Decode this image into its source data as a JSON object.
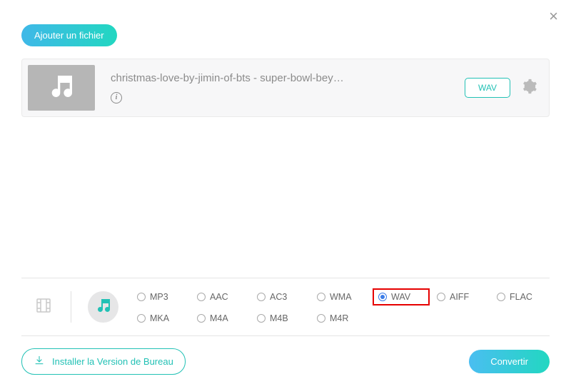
{
  "close_label": "×",
  "add_file_label": "Ajouter un fichier",
  "file": {
    "title": "christmas-love-by-jimin-of-bts - super-bowl-bey…",
    "selected_format": "WAV"
  },
  "formats": [
    {
      "name": "MP3",
      "checked": false,
      "highlighted": false
    },
    {
      "name": "AAC",
      "checked": false,
      "highlighted": false
    },
    {
      "name": "AC3",
      "checked": false,
      "highlighted": false
    },
    {
      "name": "WMA",
      "checked": false,
      "highlighted": false
    },
    {
      "name": "WAV",
      "checked": true,
      "highlighted": true
    },
    {
      "name": "AIFF",
      "checked": false,
      "highlighted": false
    },
    {
      "name": "FLAC",
      "checked": false,
      "highlighted": false
    },
    {
      "name": "MKA",
      "checked": false,
      "highlighted": false
    },
    {
      "name": "M4A",
      "checked": false,
      "highlighted": false
    },
    {
      "name": "M4B",
      "checked": false,
      "highlighted": false
    },
    {
      "name": "M4R",
      "checked": false,
      "highlighted": false
    }
  ],
  "install_label": "Installer la Version de Bureau",
  "convert_label": "Convertir"
}
